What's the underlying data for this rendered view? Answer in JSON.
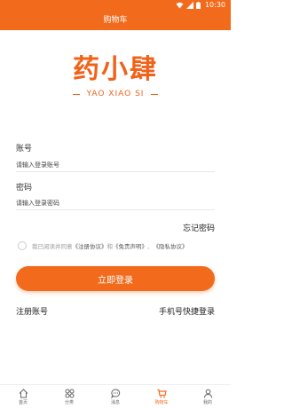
{
  "status_bar": {
    "time": "10:30",
    "icons": [
      "wifi-icon",
      "signal-icon",
      "battery-icon"
    ]
  },
  "header": {
    "title": "购物车"
  },
  "logo": {
    "main": "药小肆",
    "sub": "YAO XIAO SI"
  },
  "form": {
    "account_label": "账号",
    "account_placeholder": "请输入登录账号",
    "password_label": "密码",
    "password_placeholder": "请输入登录密码",
    "forgot": "忘记密码"
  },
  "agreement": {
    "prefix": "我已阅读并同意",
    "terms": "《注册协议》",
    "and": "和",
    "disclaimer": "《免责声明》",
    "sep": "、",
    "privacy": "《隐私协议》",
    "checked": false
  },
  "login_button": "立即登录",
  "links": {
    "register": "注册账号",
    "phone_login": "手机号快捷登录"
  },
  "tabs": [
    {
      "label": "首页",
      "icon": "home-icon"
    },
    {
      "label": "分类",
      "icon": "category-icon"
    },
    {
      "label": "消息",
      "icon": "message-icon"
    },
    {
      "label": "购物车",
      "icon": "cart-icon",
      "active": true
    },
    {
      "label": "我的",
      "icon": "user-icon"
    }
  ],
  "colors": {
    "accent": "#f26b1d",
    "text": "#222222"
  }
}
